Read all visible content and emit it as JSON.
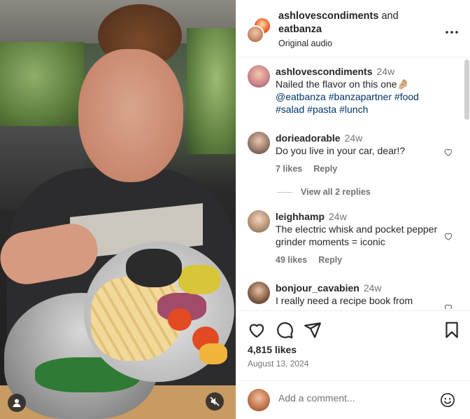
{
  "post": {
    "header": {
      "author1": "ashlovescondiments",
      "joiner": " and",
      "author2": "eatbanza",
      "audio": "Original audio",
      "more_icon": "more-horizontal-icon"
    },
    "caption": {
      "user": "ashlovescondiments",
      "time": "24w",
      "text": "Nailed the flavor on this one🤌🏼",
      "tags": [
        "@eatbanza",
        "#banzapartner",
        "#food",
        "#salad",
        "#pasta",
        "#lunch"
      ]
    },
    "comments": [
      {
        "user": "dorieadorable",
        "time": "24w",
        "text": "Do you live in your car, dear!?",
        "likes": "7 likes",
        "reply": "Reply",
        "view_replies": "View all 2 replies"
      },
      {
        "user": "leighhamp",
        "time": "24w",
        "text": "The electric whisk and pocket pepper grinder moments = iconic",
        "likes": "49 likes",
        "reply": "Reply"
      },
      {
        "user": "bonjour_cavabien",
        "time": "24w",
        "text": "I really need a recipe book from"
      }
    ],
    "actions": {
      "icons": [
        "heart-icon",
        "comment-icon",
        "share-icon",
        "bookmark-icon"
      ],
      "likes": "4,815 likes",
      "date": "August 13, 2024"
    },
    "add_comment": {
      "placeholder": "Add a comment...",
      "emoji_icon": "emoji-icon"
    },
    "media": {
      "icons": [
        "user-tag-icon",
        "muted-speaker-icon"
      ]
    }
  }
}
